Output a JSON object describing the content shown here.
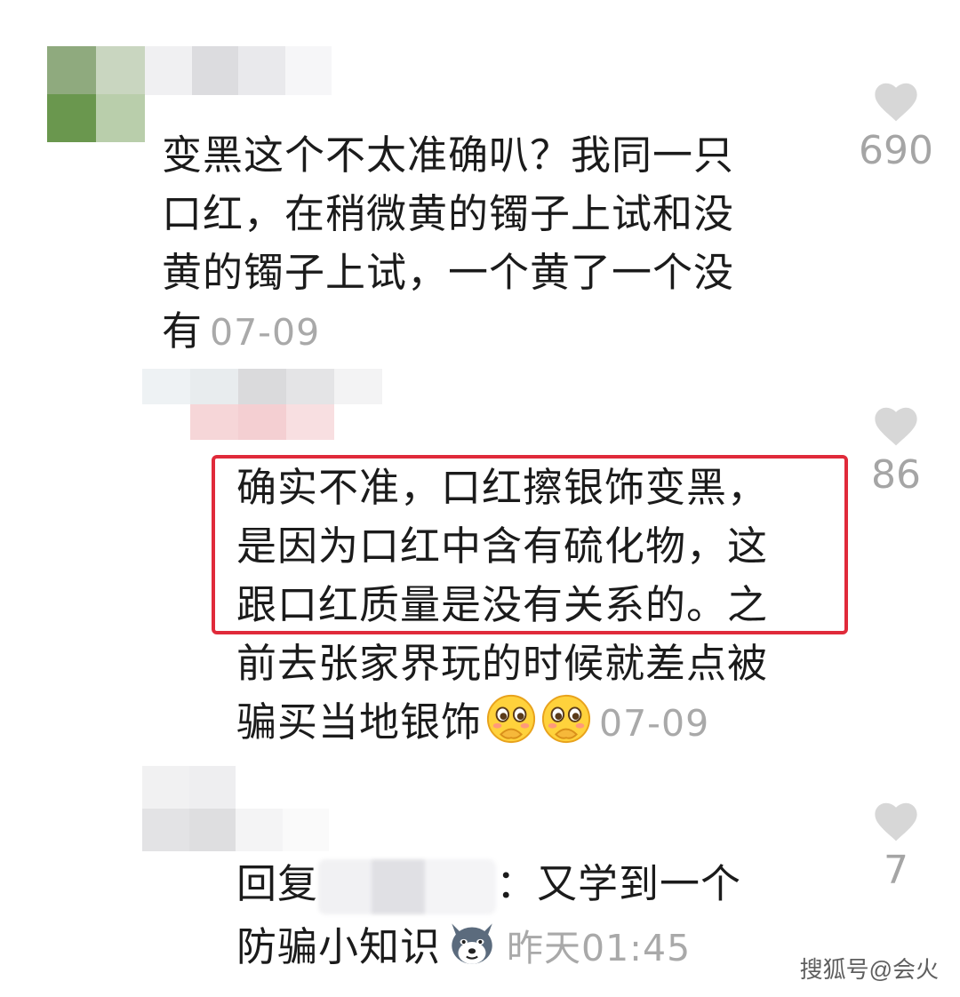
{
  "comments": [
    {
      "lines": [
        "变黑这个不太准确叭？我同一只",
        "口红，在稍微黄的镯子上试和没",
        "黄的镯子上试，一个黄了一个没",
        "有"
      ],
      "time": "07-09",
      "likes": "690"
    },
    {
      "lines": [
        "确实不准，口红擦银饰变黑，",
        "是因为口红中含有硫化物，这",
        "跟口红质量是没有关系的。之",
        "前去张家界玩的时候就差点被",
        "骗买当地银饰"
      ],
      "time": "07-09",
      "likes": "86",
      "highlight_color": "#e02a3a"
    },
    {
      "reply_prefix": "回复",
      "reply_rest_line1": "：又学到一个",
      "line2": "防骗小知识",
      "time": "昨天01:45",
      "likes": "7"
    }
  ],
  "watermark": "搜狐号@会火",
  "icons": [
    "heart-icon",
    "blushing-face-emoji",
    "doge-emoji"
  ]
}
